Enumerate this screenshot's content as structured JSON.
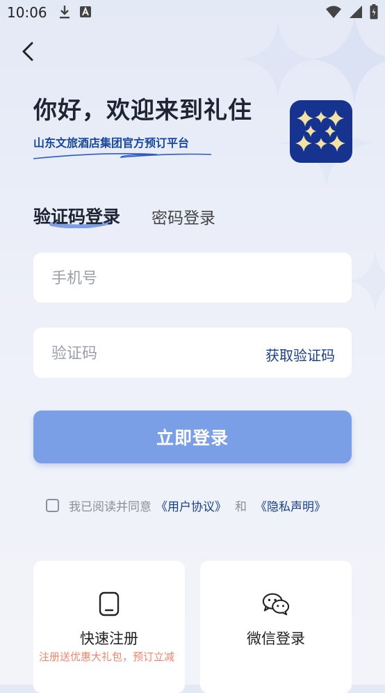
{
  "status_bar": {
    "time": "10:06",
    "icons_left": [
      "download-icon",
      "a-badge-icon"
    ],
    "icons_right": [
      "wifi-icon",
      "cellular-signal-icon",
      "battery-charging-icon"
    ]
  },
  "header": {
    "greeting": "你好，欢迎来到礼住",
    "subtitle": "山东文旅酒店集团官方预订平台",
    "logo_icon": "sparkle-stars-logo"
  },
  "tabs": [
    {
      "label": "验证码登录",
      "active": true
    },
    {
      "label": "密码登录",
      "active": false
    }
  ],
  "form": {
    "phone_placeholder": "手机号",
    "code_placeholder": "验证码",
    "get_code_label": "获取验证码",
    "login_label": "立即登录"
  },
  "agreement": {
    "prefix": "我已阅读并同意",
    "user_agreement": "《用户协议》",
    "and": "和",
    "privacy": "《隐私声明》",
    "checked": false
  },
  "quick_actions": {
    "register_label": "快速注册",
    "register_promo": "注册送优惠大礼包，预订立减",
    "wechat_label": "微信登录"
  },
  "colors": {
    "brand_navy": "#16338f",
    "link_blue": "#173f8a",
    "button_blue": "#7b9fe6",
    "promo_orange": "#f0856b",
    "star_gold": "#f2e2a6"
  }
}
